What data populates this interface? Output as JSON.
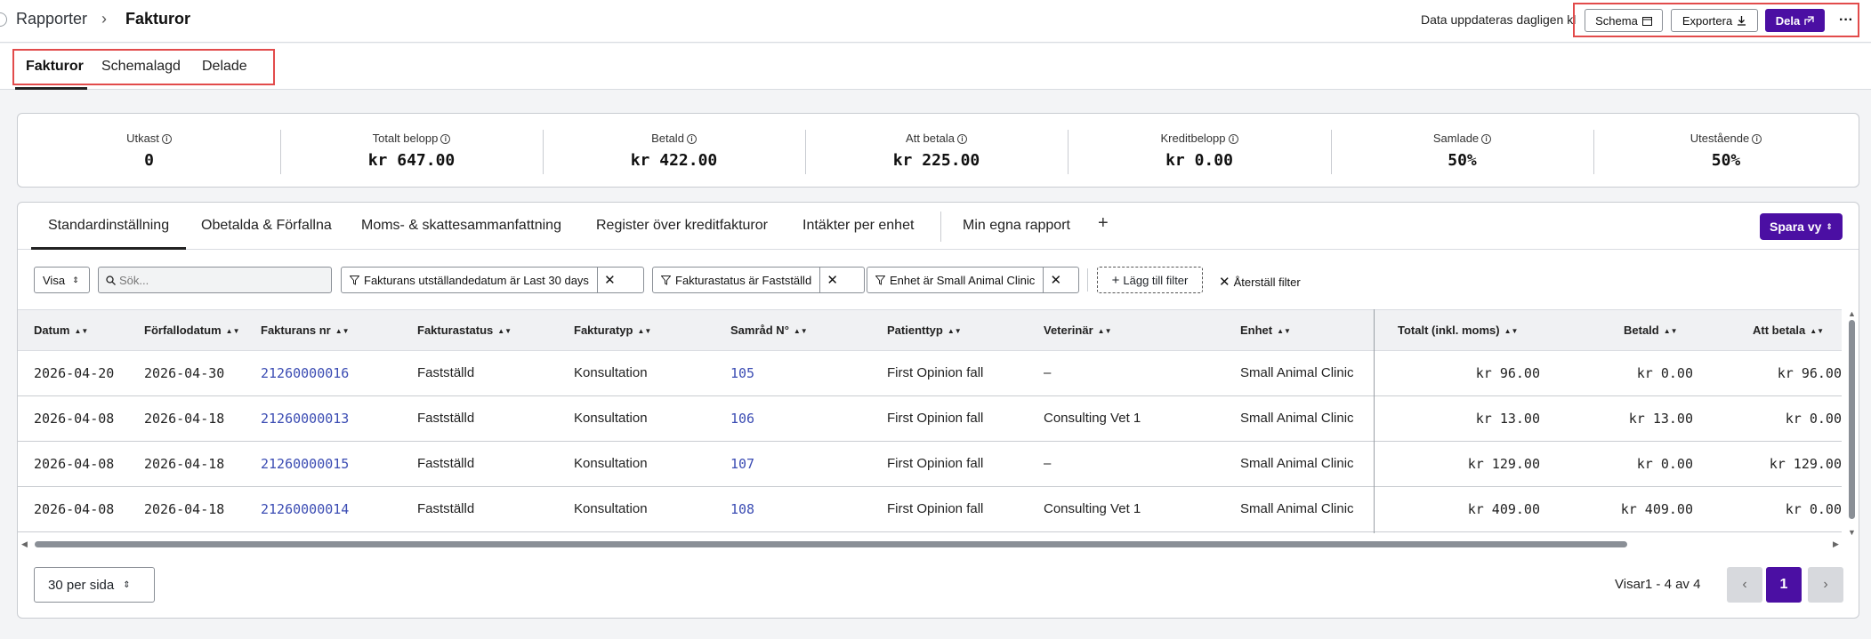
{
  "breadcrumb": {
    "parent": "Rapporter",
    "separator": "›",
    "current": "Fakturor"
  },
  "header": {
    "update_text": "Data uppdateras dagligen kl",
    "schema_label": "Schema",
    "export_label": "Exportera",
    "share_label": "Dela",
    "more_label": "···"
  },
  "tabs": [
    {
      "label": "Fakturor"
    },
    {
      "label": "Schemalagd"
    },
    {
      "label": "Delade"
    }
  ],
  "kpis": [
    {
      "label": "Utkast",
      "value": "0"
    },
    {
      "label": "Totalt belopp",
      "value": "kr 647.00"
    },
    {
      "label": "Betald",
      "value": "kr 422.00"
    },
    {
      "label": "Att betala",
      "value": "kr 225.00"
    },
    {
      "label": "Kreditbelopp",
      "value": "kr 0.00"
    },
    {
      "label": "Samlade",
      "value": "50%"
    },
    {
      "label": "Utestående",
      "value": "50%"
    }
  ],
  "view_tabs": [
    {
      "label": "Standardinställning"
    },
    {
      "label": "Obetalda & Förfallna"
    },
    {
      "label": "Moms- & skattesammanfattning"
    },
    {
      "label": "Register över kreditfakturor"
    },
    {
      "label": "Intäkter per enhet"
    },
    {
      "label": "Min egna rapport"
    }
  ],
  "add_view_label": "+",
  "save_view_label": "Spara vy",
  "filters": {
    "visa_label": "Visa",
    "search_placeholder": "Sök...",
    "chips": [
      {
        "label": "Fakturans utställandedatum är Last 30 days"
      },
      {
        "label": "Fakturastatus är Fastställd"
      },
      {
        "label": "Enhet är Small Animal Clinic"
      }
    ],
    "add_filter_label": "Lägg till filter",
    "reset_label": "Återställ filter"
  },
  "table": {
    "columns": [
      "Datum",
      "Förfallodatum",
      "Fakturans nr",
      "Fakturastatus",
      "Fakturatyp",
      "Samråd N°",
      "Patienttyp",
      "Veterinär",
      "Enhet",
      "Totalt (inkl. moms)",
      "Betald",
      "Att betala"
    ],
    "rows": [
      [
        "2026-04-20",
        "2026-04-30",
        "21260000016",
        "Fastställd",
        "Konsultation",
        "105",
        "First Opinion fall",
        "–",
        "Small Animal Clinic",
        "kr 96.00",
        "kr 0.00",
        "kr 96.00"
      ],
      [
        "2026-04-08",
        "2026-04-18",
        "21260000013",
        "Fastställd",
        "Konsultation",
        "106",
        "First Opinion fall",
        "Consulting Vet 1",
        "Small Animal Clinic",
        "kr 13.00",
        "kr 13.00",
        "kr 0.00"
      ],
      [
        "2026-04-08",
        "2026-04-18",
        "21260000015",
        "Fastställd",
        "Konsultation",
        "107",
        "First Opinion fall",
        "–",
        "Small Animal Clinic",
        "kr 129.00",
        "kr 0.00",
        "kr 129.00"
      ],
      [
        "2026-04-08",
        "2026-04-18",
        "21260000014",
        "Fastställd",
        "Konsultation",
        "108",
        "First Opinion fall",
        "Consulting Vet 1",
        "Small Animal Clinic",
        "kr 409.00",
        "kr 409.00",
        "kr 0.00"
      ]
    ]
  },
  "footer": {
    "per_page_label": "30 per sida",
    "showing_text": "Visar1 - 4 av 4",
    "current_page": "1",
    "prev_label": "‹",
    "next_label": "›"
  },
  "colors": {
    "accent": "#4b0fa3",
    "link": "#3b4cb3",
    "highlight_box": "#e24b4b"
  }
}
